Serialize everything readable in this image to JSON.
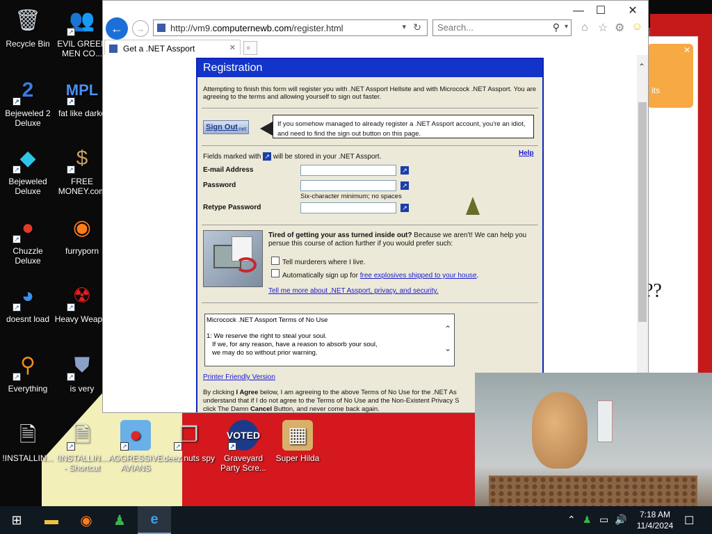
{
  "desktop": {
    "icons": [
      {
        "label": "Recycle Bin",
        "icon": "recycle-bin-icon"
      },
      {
        "label": "EVIL GREEN MEN CO...",
        "icon": "green-men-icon"
      },
      {
        "label": "Bejeweled 2 Deluxe",
        "icon": "bejeweled2-icon"
      },
      {
        "label": "fat like darko",
        "icon": "mpl-icon"
      },
      {
        "label": "Bejeweled Deluxe",
        "icon": "diamond-icon"
      },
      {
        "label": "FREE MONEY.com",
        "icon": "money-bag-icon"
      },
      {
        "label": "Chuzzle Deluxe",
        "icon": "chuzzle-icon"
      },
      {
        "label": "furryporn",
        "icon": "firefox-icon"
      },
      {
        "label": "doesnt load",
        "icon": "thunderbird-icon"
      },
      {
        "label": "Heavy Weap...",
        "icon": "radiation-icon"
      },
      {
        "label": "Everything",
        "icon": "search-ring-icon"
      },
      {
        "label": "is very",
        "icon": "mpl-shield-icon"
      },
      {
        "label": "!INSTALLIN...",
        "icon": "document-icon"
      },
      {
        "label": "!INSTALLIN... - Shortcut",
        "icon": "document-icon"
      },
      {
        "label": "AGGRESSIVE AVIANS",
        "icon": "angry-bird-icon"
      },
      {
        "label": "deez nuts spy",
        "icon": "windows-stack-icon"
      },
      {
        "label": "Graveyard Party Scre...",
        "icon": "voted-icon"
      },
      {
        "label": "Super Hilda",
        "icon": "pixel-dog-icon"
      }
    ]
  },
  "browser": {
    "address_url_prefix": "http://vm9.",
    "address_url_domain": "computernewb.com",
    "address_url_path": "/register.html",
    "search_placeholder": "Search...",
    "tab_title": "Get a .NET Assport",
    "window_controls": {
      "minimize": "—",
      "maximize": "☐",
      "close": "✕"
    }
  },
  "registration": {
    "header": "Registration",
    "intro": "Attempting to finish this form will register you with .NET Assport Hellsite and with Microcock .NET Assport. You are agreeing to the terms and allowing yourself to sign out faster.",
    "sign_out_label": "Sign Out",
    "sign_out_net": ".net",
    "sign_out_note": "If you somehow managed to already register a .NET Assport account, you're an idiot, and need to find the sign out button on this page.",
    "fields_note_pre": "Fields marked with",
    "fields_note_post": "will be stored in your .NET Assport.",
    "help": "Help",
    "email_label": "E-mail Address",
    "password_label": "Password",
    "password_hint": "Six-character minimum; no spaces",
    "retype_label": "Retype Password",
    "tired_bold": "Tired of getting your ass turned inside out?",
    "tired_rest": "Because we aren't! We can help you persue this course of action further if you would prefer such:",
    "check1": "Tell murderers where I live.",
    "check2_pre": "Automatically sign up for",
    "check2_link": "free explosives shipped to your house",
    "check2_post": ".",
    "tell_more": "Tell me more about .NET Assport, privacy, and security.",
    "tos_title": "Microcock .NET Assport Terms of No Use",
    "tos_line1": "1: We reserve the right to steal your soul.",
    "tos_line2": "If we, for any reason, have a reason to absorb your soul,",
    "tos_line3": "we may do so without prior warning.",
    "printer": "Printer Friendly Version",
    "agree_1a": "By clicking ",
    "agree_1b": "I Agree",
    "agree_1c": " below, I am agreeing to the above Terms of No Use for the .NET As",
    "agree_2": "understand that if I do not agree to the Terms of No Use and the Non-Existent Privacy S",
    "agree_3a": "click The Damn ",
    "agree_3b": "Cancel",
    "agree_3c": " Button, and never come back again."
  },
  "background_page": {
    "text_fragment": "??",
    "menu_fragment": "its"
  },
  "taskbar": {
    "time": "7:18 AM",
    "date": "11/4/2024"
  }
}
